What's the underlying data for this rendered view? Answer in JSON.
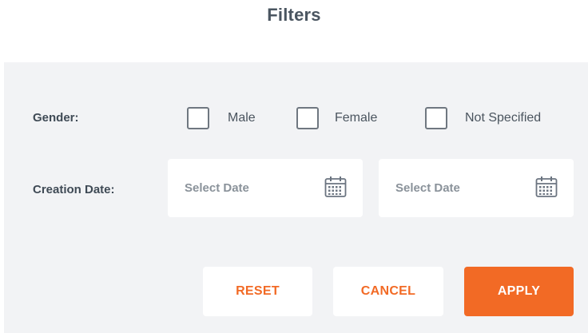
{
  "title": "Filters",
  "gender": {
    "label": "Gender:",
    "options": [
      {
        "label": "Male",
        "checked": false
      },
      {
        "label": "Female",
        "checked": false
      },
      {
        "label": "Not Specified",
        "checked": false
      }
    ]
  },
  "creation_date": {
    "label": "Creation Date:",
    "from_placeholder": "Select Date",
    "to_placeholder": "Select Date",
    "icon": "calendar-icon"
  },
  "actions": {
    "reset_label": "RESET",
    "cancel_label": "CANCEL",
    "apply_label": "APPLY"
  },
  "colors": {
    "accent": "#f26a25",
    "panel_background": "#f2f3f5",
    "text": "#3f4a55"
  }
}
